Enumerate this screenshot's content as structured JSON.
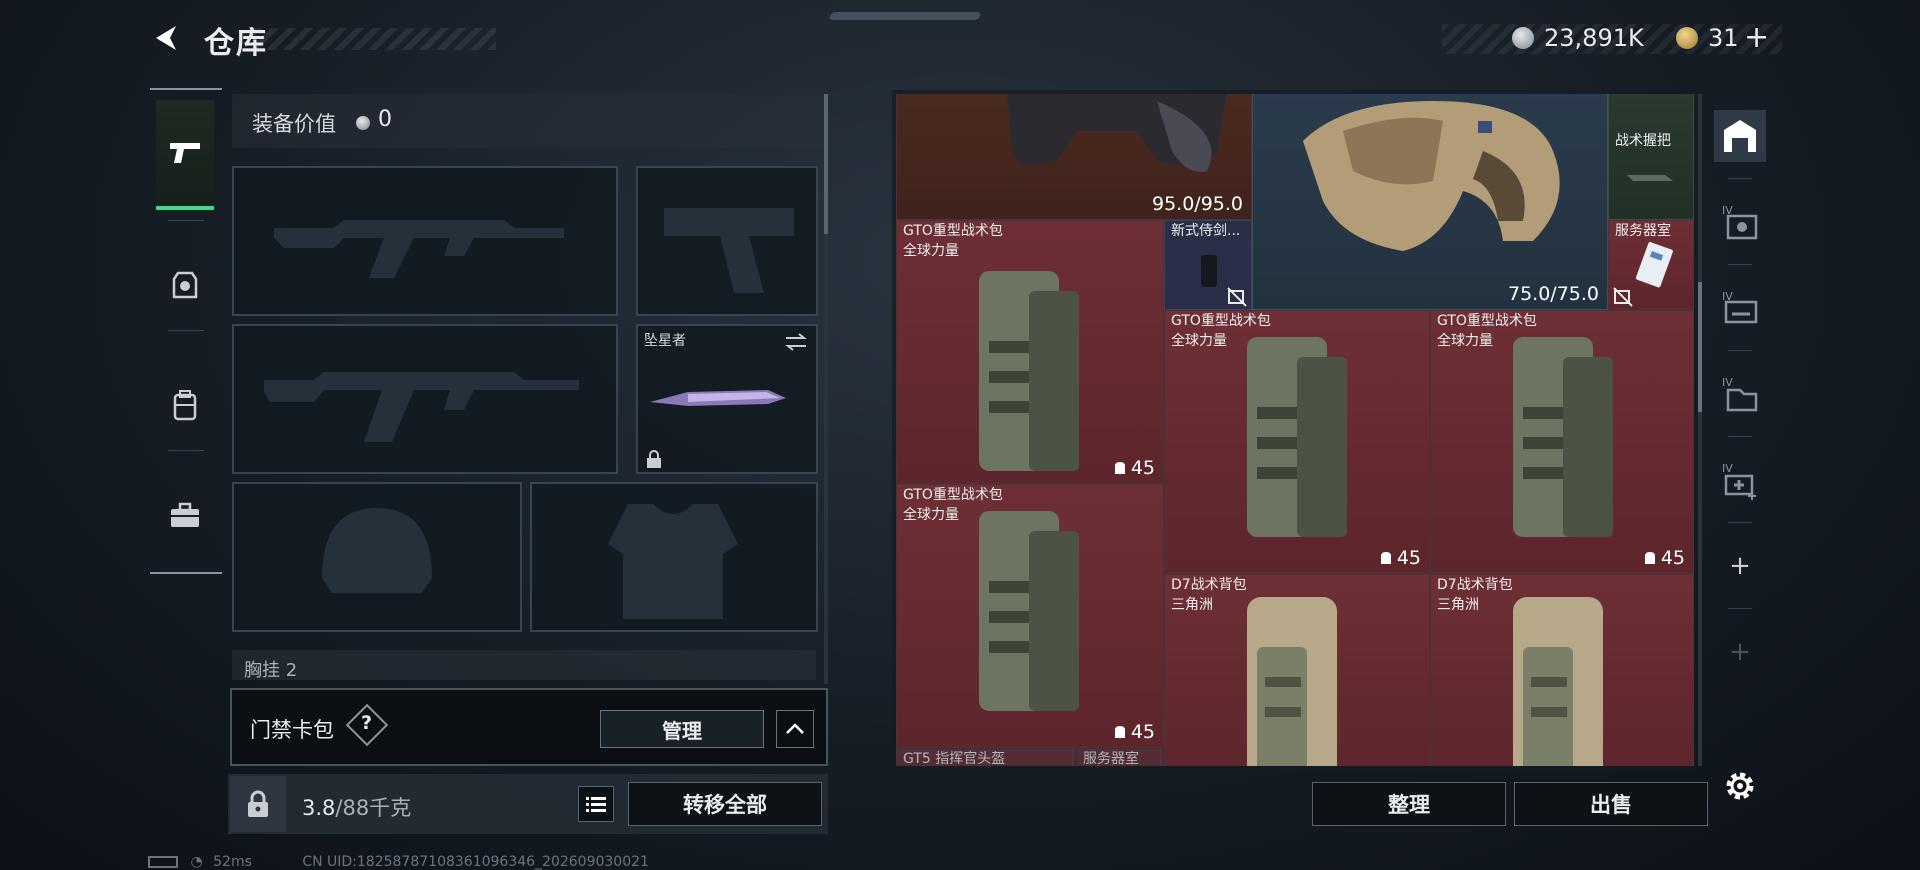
{
  "header": {
    "title": "仓库",
    "money": "23,891K",
    "tokens": "31",
    "add_label": "+"
  },
  "loadout": {
    "equip_value_label": "装备价值",
    "equip_value": "0",
    "melee_slot_label": "坠星者",
    "chest_label": "胸挂",
    "chest_count": "2"
  },
  "keycard": {
    "label": "门禁卡包",
    "help": "?",
    "manage_label": "管理"
  },
  "weight": {
    "current": "3.8",
    "max": "/88千克",
    "transfer_label": "转移全部"
  },
  "storage": {
    "items": [
      {
        "name": "",
        "sub": "",
        "value": "95.0/95.0"
      },
      {
        "name": "",
        "sub": "",
        "value": "75.0/75.0"
      },
      {
        "name": "战术握把",
        "sub": ""
      },
      {
        "name": "GTO重型战术包",
        "sub": "全球力量",
        "capacity": "45"
      },
      {
        "name": "新式侍剑...",
        "sub": ""
      },
      {
        "name": "服务器室",
        "sub": ""
      },
      {
        "name": "GTO重型战术包",
        "sub": "全球力量",
        "capacity": "45"
      },
      {
        "name": "GTO重型战术包",
        "sub": "全球力量",
        "capacity": "45"
      },
      {
        "name": "GTO重型战术包",
        "sub": "全球力量",
        "capacity": "45"
      },
      {
        "name": "D7战术背包",
        "sub": "三角洲"
      },
      {
        "name": "D7战术背包",
        "sub": "三角洲"
      },
      {
        "name": "GT5 指挥官头盔",
        "sub": ""
      },
      {
        "name": "服务器室",
        "sub": ""
      }
    ],
    "sort_label": "整理",
    "sell_label": "出售"
  },
  "right_nav": {
    "plus": "+"
  },
  "status": {
    "ping": "52ms",
    "uid": "CN UID:18258787108361096346_202609030021"
  },
  "colors": {
    "accent_green": "#41d98a",
    "item_red": "#6e2f36",
    "grid_blue": "#1c2a3a"
  }
}
